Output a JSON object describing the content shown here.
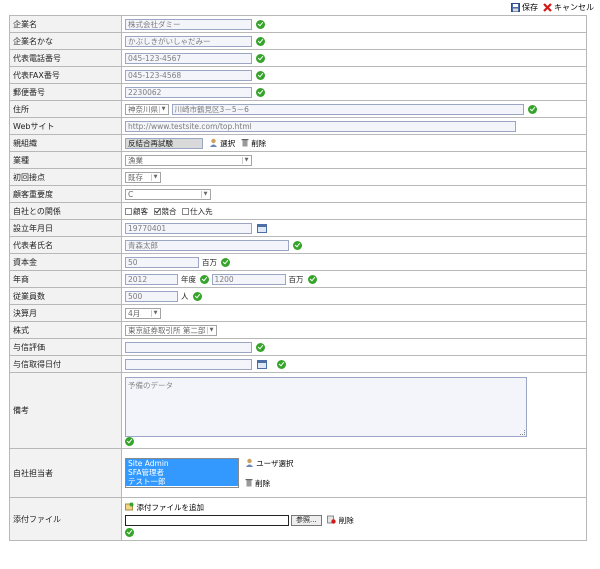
{
  "toolbar": {
    "save_label": "保存",
    "cancel_label": "キャンセル"
  },
  "fields": {
    "company_name": {
      "label": "企業名",
      "value": "株式会社ダミー"
    },
    "company_kana": {
      "label": "企業名かな",
      "value": "かぶしきがいしゃだみー"
    },
    "phone": {
      "label": "代表電話番号",
      "value": "045-123-4567"
    },
    "fax": {
      "label": "代表FAX番号",
      "value": "045-123-4568"
    },
    "postal": {
      "label": "郵便番号",
      "value": "2230062"
    },
    "address": {
      "label": "住所",
      "prefecture": "神奈川県",
      "street": "川崎市鶴見区3－5－6"
    },
    "website": {
      "label": "Webサイト",
      "value": "http://www.testsite.com/top.html"
    },
    "parent_org": {
      "label": "親組織",
      "value": "反結合再試験",
      "select_label": "選択",
      "delete_label": "削除"
    },
    "industry": {
      "label": "業種",
      "value": "漁業"
    },
    "first_contact": {
      "label": "初回接点",
      "value": "既存"
    },
    "importance": {
      "label": "顧客重要度",
      "value": "C"
    },
    "relation": {
      "label": "自社との関係",
      "options": [
        {
          "label": "顧客",
          "checked": false
        },
        {
          "label": "競合",
          "checked": true
        },
        {
          "label": "仕入先",
          "checked": false
        }
      ]
    },
    "founded": {
      "label": "設立年月日",
      "value": "19770401"
    },
    "representative": {
      "label": "代表者氏名",
      "value": "青森太郎"
    },
    "capital": {
      "label": "資本金",
      "value": "50",
      "unit": "百万"
    },
    "revenue": {
      "label": "年商",
      "year": "2012",
      "year_unit": "年度",
      "amount": "1200",
      "amount_unit": "百万"
    },
    "employees": {
      "label": "従業員数",
      "value": "500",
      "unit": "人"
    },
    "fiscal_month": {
      "label": "決算月",
      "value": "4月"
    },
    "stock": {
      "label": "株式",
      "value": "東京証券取引所 第二部"
    },
    "credit_rating": {
      "label": "与信評価",
      "value": ""
    },
    "credit_date": {
      "label": "与信取得日付",
      "value": ""
    },
    "notes": {
      "label": "備考",
      "value": "予備のデータ"
    },
    "owner": {
      "label": "自社担当者",
      "users": [
        "Site Admin",
        "SFA管理者",
        "テスト一郎"
      ],
      "select_label": "ユーザ選択",
      "delete_label": "削除"
    },
    "attachment": {
      "label": "添付ファイル",
      "add_label": "添付ファイルを追加",
      "browse_label": "参照...",
      "delete_label": "削除"
    }
  },
  "colors": {
    "ok_green": "#35a42a",
    "select_blue": "#3399ff",
    "label_bg": "#f2f2f2"
  }
}
